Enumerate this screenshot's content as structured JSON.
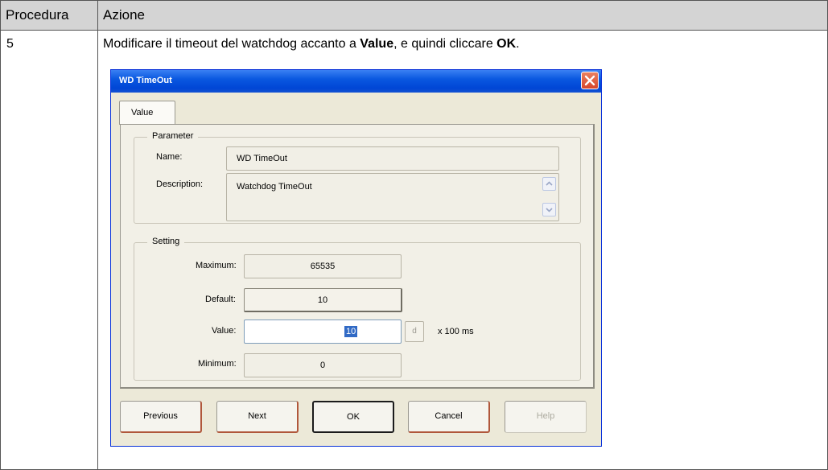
{
  "table": {
    "header_col1": "Procedura",
    "header_col2": "Azione",
    "step": "5",
    "instruction_pre": "Modificare il timeout del watchdog accanto a ",
    "instruction_value": "Value",
    "instruction_mid": ", e quindi cliccare ",
    "instruction_ok": "OK",
    "instruction_end": "."
  },
  "dialog": {
    "title": "WD TimeOut",
    "tab_label": "Value",
    "parameter": {
      "group_label": "Parameter",
      "name_label": "Name:",
      "name_value": "WD TimeOut",
      "description_label": "Description:",
      "description_value": "Watchdog TimeOut"
    },
    "setting": {
      "group_label": "Setting",
      "maximum_label": "Maximum:",
      "maximum_value": "65535",
      "default_label": "Default:",
      "default_value": "10",
      "value_label": "Value:",
      "value_value": "10",
      "d_button": "d",
      "unit": "x 100 ms",
      "minimum_label": "Minimum:",
      "minimum_value": "0"
    },
    "buttons": {
      "previous": "Previous",
      "next": "Next",
      "ok": "OK",
      "cancel": "Cancel",
      "help": "Help"
    }
  },
  "colors": {
    "titlebar": "#0a58e0",
    "dialog_bg": "#ece9d8",
    "selection": "#316ac5",
    "header_bg": "#d4d4d4"
  }
}
